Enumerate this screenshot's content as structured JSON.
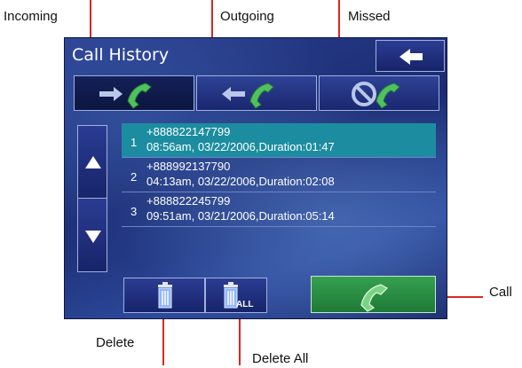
{
  "callouts": {
    "incoming": "Incoming",
    "outgoing": "Outgoing",
    "missed": "Missed",
    "call": "Call",
    "delete": "Delete",
    "delete_all": "Delete All"
  },
  "screen": {
    "title": "Call History",
    "tabs": [
      {
        "name": "incoming",
        "icon": "incoming-call-icon",
        "active": true
      },
      {
        "name": "outgoing",
        "icon": "outgoing-call-icon",
        "active": false
      },
      {
        "name": "missed",
        "icon": "missed-call-icon",
        "active": false
      }
    ],
    "records": [
      {
        "index": "1",
        "number": "+888822147799",
        "detail": "08:56am, 03/22/2006,Duration:01:47",
        "selected": true
      },
      {
        "index": "2",
        "number": "+888992137790",
        "detail": "04:13am, 03/22/2006,Duration:02:08",
        "selected": false
      },
      {
        "index": "3",
        "number": "+888822245799",
        "detail": "09:51am, 03/21/2006,Duration:05:14",
        "selected": false
      }
    ],
    "delete_all_tag": "ALL"
  },
  "colors": {
    "selected_row": "#1c8da0",
    "callout_line": "#d82727",
    "call_button": "#2e8f47"
  }
}
